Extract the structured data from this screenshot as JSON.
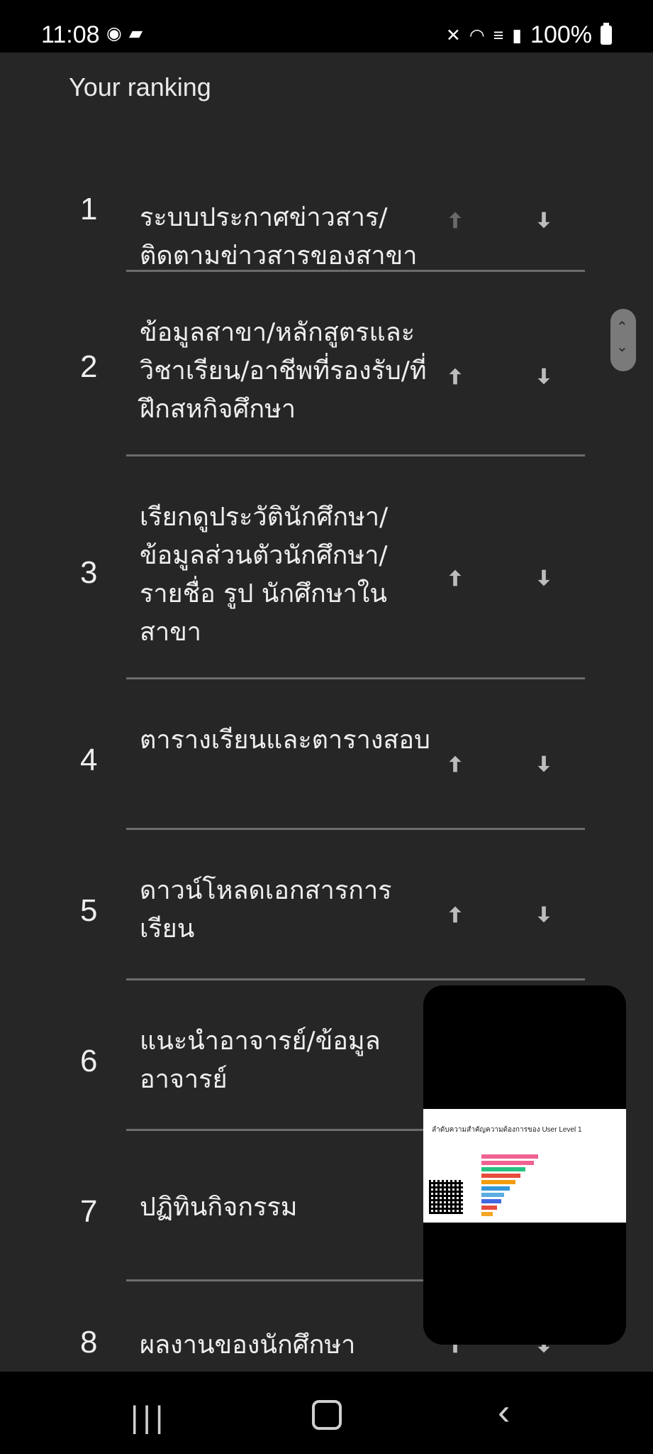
{
  "status": {
    "time": "11:08",
    "left_icons": [
      "messenger-icon",
      "video-call-icon"
    ],
    "right_icons": [
      "mute-icon",
      "wifi-icon",
      "volte-icon",
      "signal-icon"
    ],
    "battery": "100%"
  },
  "page": {
    "heading": "Your ranking",
    "items": [
      {
        "rank": "1",
        "label": "ระบบประกาศข่าวสาร/ติดตามข่าวสารของสาขา"
      },
      {
        "rank": "2",
        "label": "ข้อมูลสาขา/หลักสูตรและวิชาเรียน/อาชีพที่รองรับ/ที่ฝึกสหกิจศึกษา"
      },
      {
        "rank": "3",
        "label": "เรียกดูประวัตินักศึกษา/ข้อมูลส่วนตัวนักศึกษา/รายชื่อ รูป นักศึกษาในสาขา"
      },
      {
        "rank": "4",
        "label": "ตารางเรียนและตารางสอบ"
      },
      {
        "rank": "5",
        "label": "ดาวน์โหลดเอกสารการเรียน"
      },
      {
        "rank": "6",
        "label": "แนะนำอาจารย์/ข้อมูลอาจารย์"
      },
      {
        "rank": "7",
        "label": "ปฏิทินกิจกรรม"
      },
      {
        "rank": "8",
        "label": "ผลงานของนักศึกษา"
      }
    ]
  },
  "floating_window": {
    "title": "ลำดับความสำคัญความต้องการของ User Level 1",
    "bar_colors": [
      "#f06292",
      "#f06292",
      "#26c281",
      "#e74c3c",
      "#f39c12",
      "#3498db",
      "#5dade2",
      "#4169e1",
      "#e74c3c",
      "#f5a623"
    ]
  },
  "nav": {
    "icons": [
      "recents-icon",
      "home-icon",
      "back-icon"
    ]
  }
}
